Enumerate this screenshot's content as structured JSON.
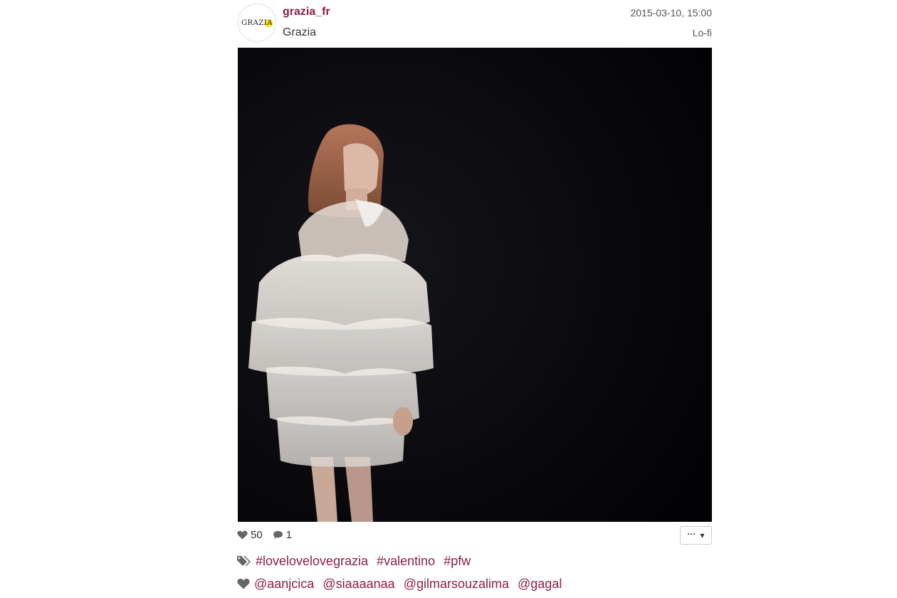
{
  "post": {
    "username": "grazia_fr",
    "full_name": "Grazia",
    "timestamp": "2015-03-10, 15:00",
    "filter": "Lo-fi",
    "avatar_text": "GRAZIA",
    "avatar_accent": "#f5e21a",
    "brand_color": "#8e1e44"
  },
  "stats": {
    "likes": "50",
    "comments": "1"
  },
  "menu": {
    "dots": "···",
    "caret": "▾"
  },
  "tags": [
    "#lovelovelovegrazia",
    "#valentino",
    "#pfw"
  ],
  "mentions": [
    "@aanjcica",
    "@siaaaanaa",
    "@gilmarsouzalima",
    "@gagal"
  ],
  "icons": {
    "like": "heart-icon",
    "comment": "speech-bubble-icon",
    "tags": "tags-icon",
    "mentions": "heart-icon"
  }
}
